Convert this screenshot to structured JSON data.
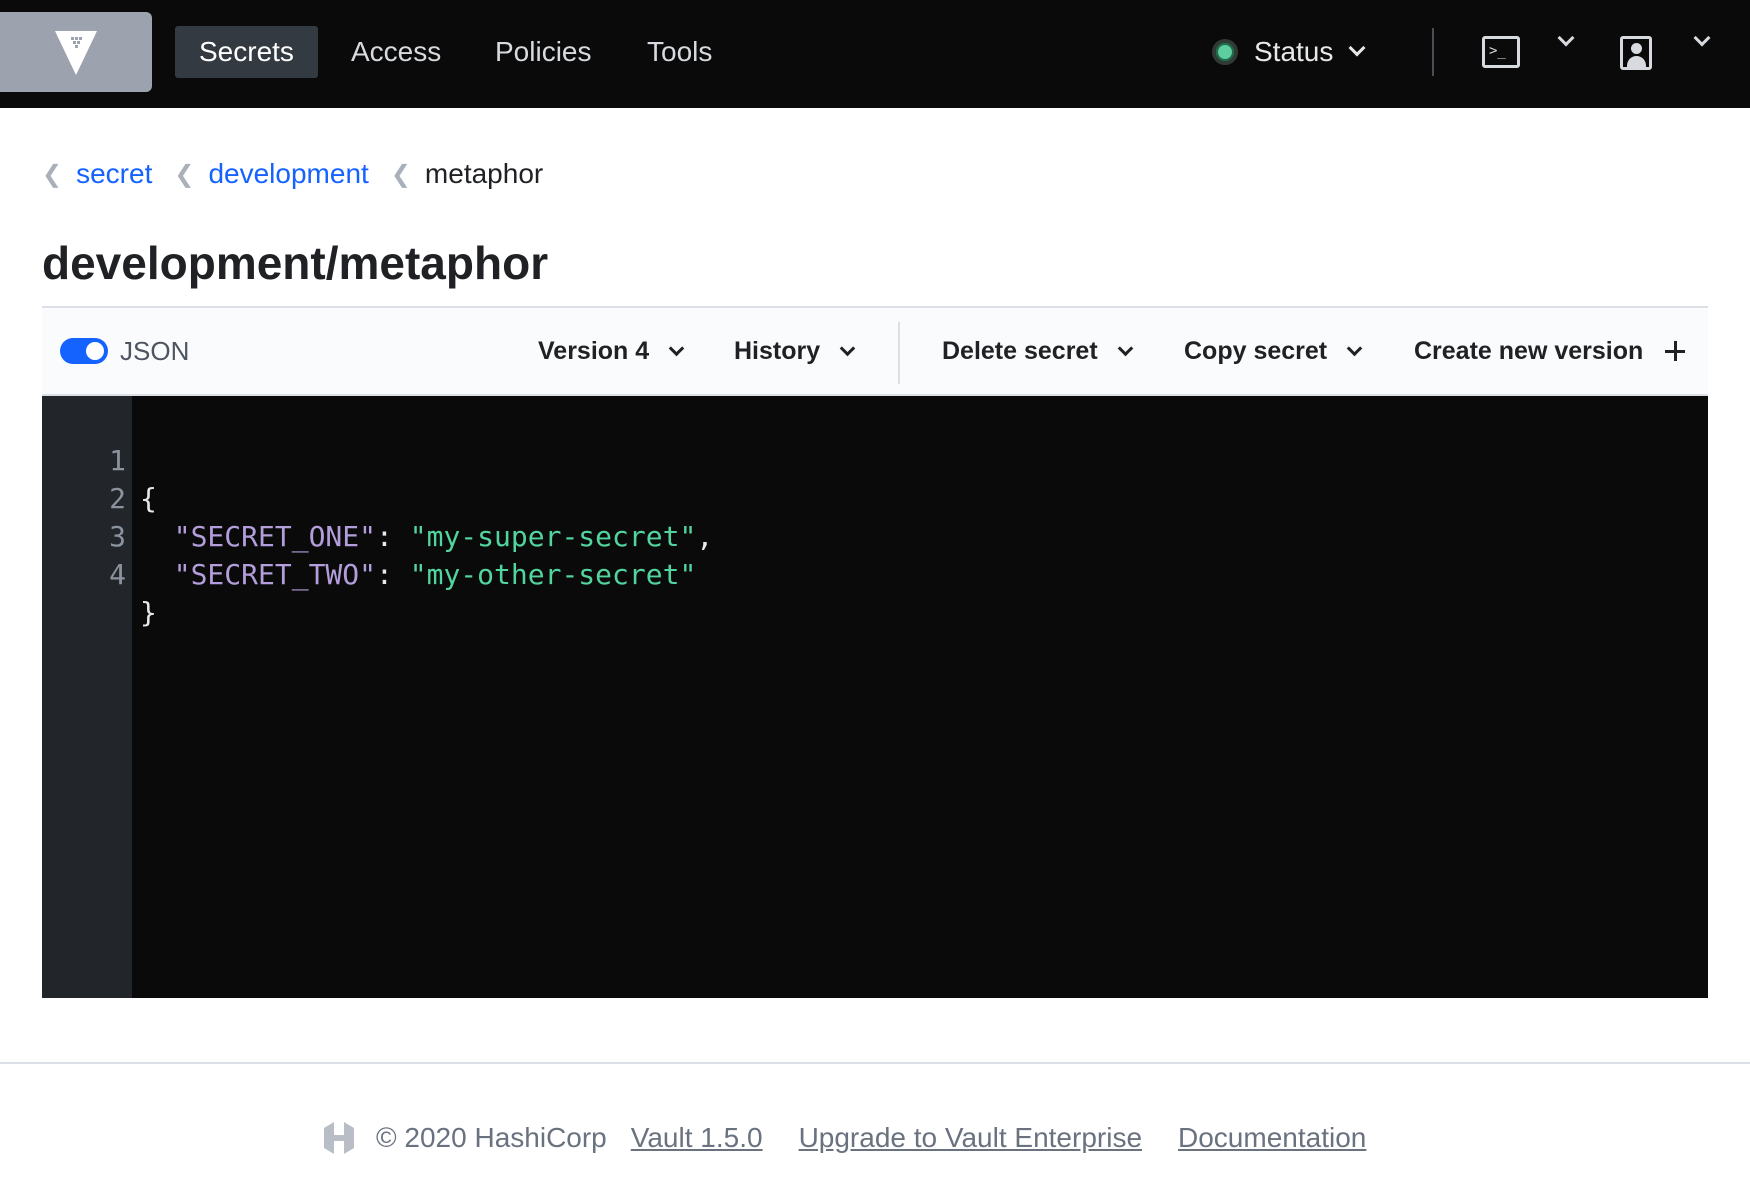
{
  "nav": {
    "items": [
      {
        "label": "Secrets",
        "active": true
      },
      {
        "label": "Access",
        "active": false
      },
      {
        "label": "Policies",
        "active": false
      },
      {
        "label": "Tools",
        "active": false
      }
    ],
    "status_label": "Status",
    "status_color": "#5fcca0"
  },
  "breadcrumb": [
    {
      "label": "secret",
      "link": true
    },
    {
      "label": "development",
      "link": true
    },
    {
      "label": "metaphor",
      "link": false
    }
  ],
  "page_title": "development/metaphor",
  "toolbar": {
    "json_toggle_label": "JSON",
    "json_toggle_on": true,
    "version_label": "Version 4",
    "history_label": "History",
    "delete_label": "Delete secret",
    "copy_label": "Copy secret",
    "create_label": "Create new version"
  },
  "editor": {
    "lines": [
      {
        "n": "1",
        "text": "{"
      },
      {
        "n": "2",
        "key": "\"SECRET_ONE\"",
        "value": "\"my-super-secret\"",
        "trail": ","
      },
      {
        "n": "3",
        "key": "\"SECRET_TWO\"",
        "value": "\"my-other-secret\"",
        "trail": ""
      },
      {
        "n": "4",
        "text": "}"
      }
    ]
  },
  "footer": {
    "copyright": "© 2020 HashiCorp",
    "version_link": "Vault 1.5.0",
    "upgrade_link": "Upgrade to Vault Enterprise",
    "docs_link": "Documentation"
  },
  "colors": {
    "accent": "#1563ff",
    "nav_bg": "#0a0a0a",
    "json_key": "#b39ddb",
    "json_string": "#52d49e"
  }
}
